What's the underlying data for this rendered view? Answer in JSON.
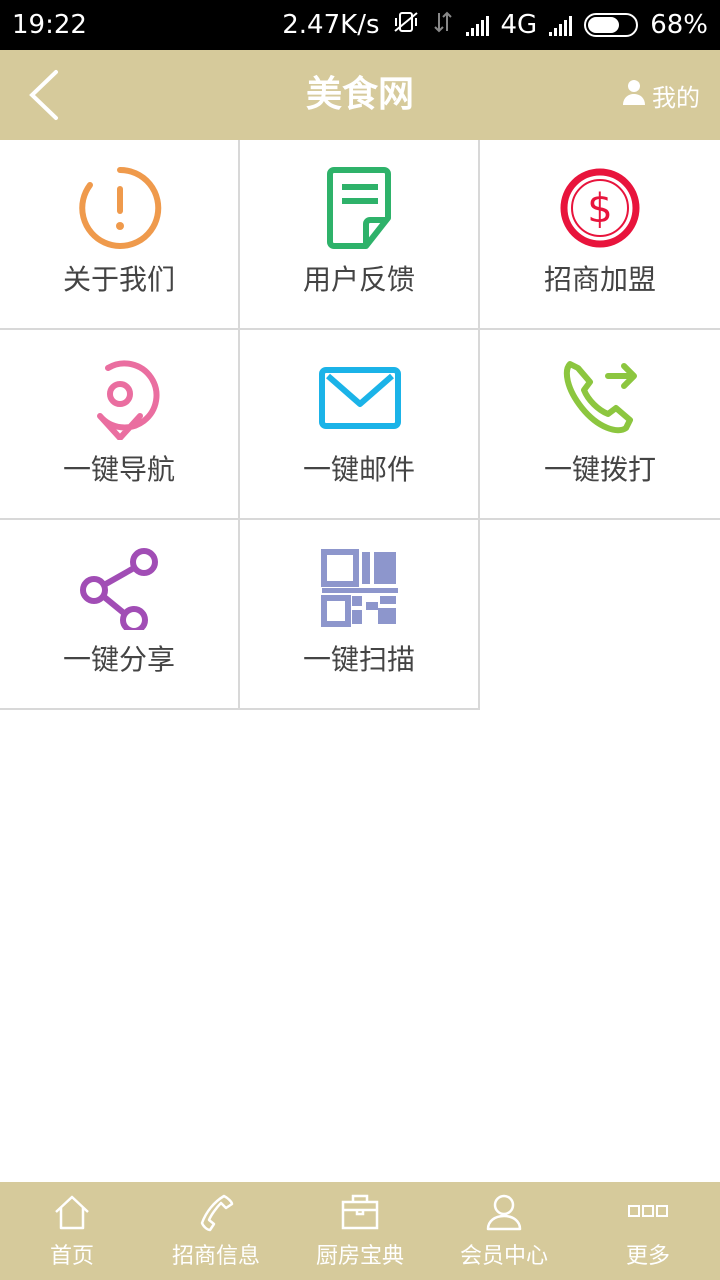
{
  "status": {
    "time": "19:22",
    "speed": "2.47K/s",
    "network": "4G",
    "battery": "68%",
    "battery_level": 0.68
  },
  "header": {
    "title": "美食网",
    "mine_label": "我的"
  },
  "grid": [
    {
      "label": "关于我们",
      "icon": "info-circle-icon",
      "color": "#ef9a4c"
    },
    {
      "label": "用户反馈",
      "icon": "feedback-note-icon",
      "color": "#2eb26a"
    },
    {
      "label": "招商加盟",
      "icon": "dollar-circle-icon",
      "color": "#e8143c"
    },
    {
      "label": "一键导航",
      "icon": "location-pin-icon",
      "color": "#ea6ea0"
    },
    {
      "label": "一键邮件",
      "icon": "mail-icon",
      "color": "#1bb3e8"
    },
    {
      "label": "一键拨打",
      "icon": "phone-call-icon",
      "color": "#8cc63f"
    },
    {
      "label": "一键分享",
      "icon": "share-icon",
      "color": "#a14db5"
    },
    {
      "label": "一键扫描",
      "icon": "qr-code-icon",
      "color": "#8d96cc"
    }
  ],
  "tabs": [
    {
      "label": "首页",
      "icon": "home-icon"
    },
    {
      "label": "招商信息",
      "icon": "phone-icon"
    },
    {
      "label": "厨房宝典",
      "icon": "briefcase-icon"
    },
    {
      "label": "会员中心",
      "icon": "user-icon"
    },
    {
      "label": "更多",
      "icon": "more-icon"
    }
  ]
}
